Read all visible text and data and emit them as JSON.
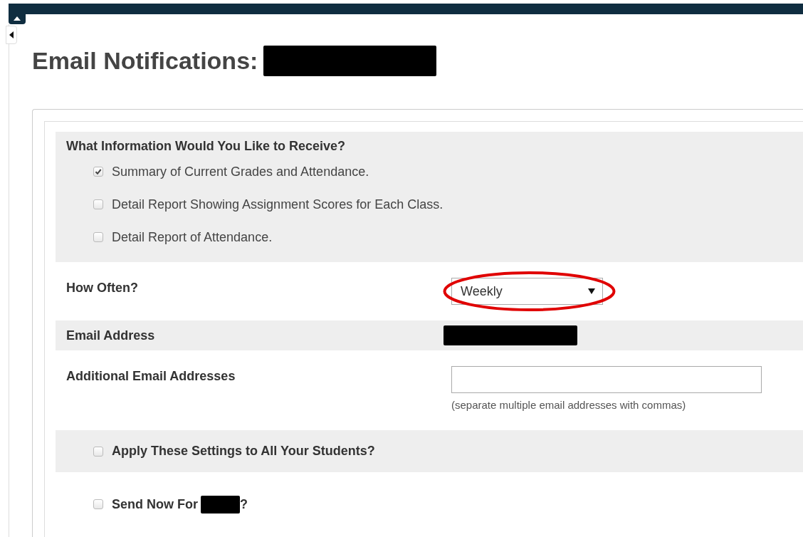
{
  "page": {
    "title": "Email Notifications:",
    "title_redacted": true
  },
  "info_section": {
    "heading": "What Information Would You Like to Receive?",
    "options": [
      {
        "label": "Summary of Current Grades and Attendance.",
        "checked": true
      },
      {
        "label": "Detail Report Showing Assignment Scores for Each Class.",
        "checked": false
      },
      {
        "label": "Detail Report of Attendance.",
        "checked": false
      }
    ]
  },
  "how_often": {
    "label": "How Often?",
    "value": "Weekly",
    "circled": true
  },
  "email_address": {
    "label": "Email Address",
    "redacted": true
  },
  "additional_emails": {
    "label": "Additional Email Addresses",
    "hint": "(separate multiple email addresses with commas)"
  },
  "apply_all": {
    "label": "Apply These Settings to All Your Students?",
    "checked": false
  },
  "send_now": {
    "label": "Send Now For",
    "redacted": true,
    "suffix": "?",
    "checked": false
  }
}
